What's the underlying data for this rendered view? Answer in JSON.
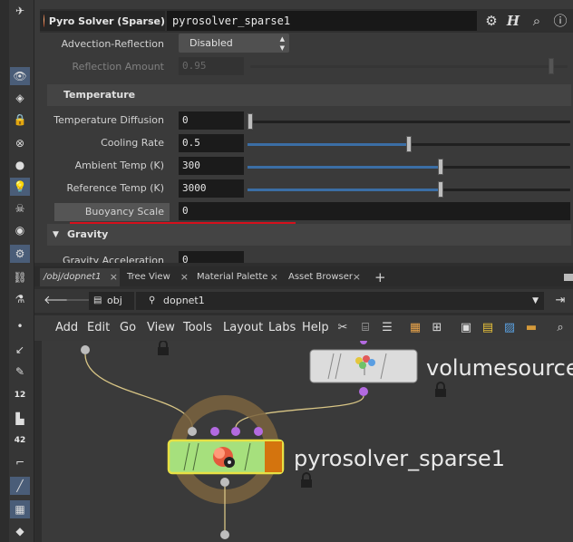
{
  "param_panel": {
    "node_type": "Pyro Solver (Sparse)",
    "node_name": "pyrosolver_sparse1",
    "header_icons": [
      "gear-icon",
      "help-h-icon",
      "search-icon",
      "info-icon"
    ],
    "advection_label": "Advection-Reflection",
    "advection_value": "Disabled",
    "reflection_label": "Reflection Amount",
    "reflection_value": "0.95",
    "section_temperature": "Temperature",
    "params": [
      {
        "label": "Temperature Diffusion",
        "value": "0",
        "slider": 0.0
      },
      {
        "label": "Cooling Rate",
        "value": "0.5",
        "slider": 0.5
      },
      {
        "label": "Ambient Temp (K)",
        "value": "300",
        "slider": 0.6
      },
      {
        "label": "Reference Temp (K)",
        "value": "3000",
        "slider": 0.6
      }
    ],
    "buoyancy_label": "Buoyancy Scale",
    "buoyancy_value": "0",
    "section_gravity": "Gravity",
    "gravity_label": "Gravity Acceleration",
    "gravity_value": "0"
  },
  "network": {
    "tabs": [
      "/obj/dopnet1",
      "Tree View",
      "Material Palette",
      "Asset Browser"
    ],
    "path": [
      "obj",
      "dopnet1"
    ],
    "menu": [
      "Add",
      "Edit",
      "Go",
      "View",
      "Tools",
      "Layout",
      "Labs",
      "Help"
    ],
    "nodes": {
      "volumesource": "volumesource",
      "pyrosolver": "pyrosolver_sparse1"
    }
  }
}
